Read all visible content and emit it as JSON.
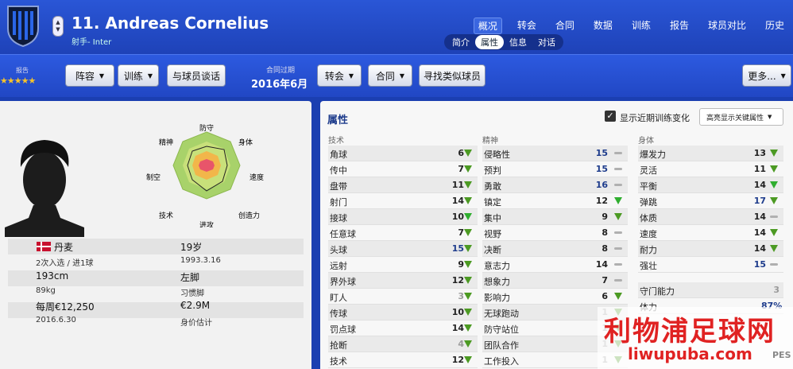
{
  "header": {
    "player_name": "11. Andreas Cornelius",
    "subtitle": "射手- Inter",
    "updown": [
      "▲",
      "▼"
    ]
  },
  "nav": [
    "概况",
    "转会",
    "合同",
    "数据",
    "训练",
    "报告",
    "球员对比",
    "历史"
  ],
  "subtabs": [
    "简介",
    "属性",
    "信息",
    "对话"
  ],
  "toolbar": {
    "report_label": "报告",
    "stars": "★★★★★",
    "lineup": "阵容",
    "training": "训练",
    "talk": "与球员谈话",
    "contract_exp_label": "合同过期",
    "contract_exp_date": "2016年6月",
    "transfer": "转会",
    "contract": "合同",
    "find_similar": "寻找类似球员",
    "more": "更多..."
  },
  "radar": {
    "labels": [
      "防守",
      "身体",
      "速度",
      "创造力",
      "进攻",
      "技术",
      "制空",
      "精神"
    ]
  },
  "profile": {
    "nation": "丹麦",
    "age": "19岁",
    "caps": "2次入选 / 进1球",
    "dob": "1993.3.16",
    "height": "193cm",
    "foot": "左脚",
    "weight": "89kg",
    "foot_label": "习惯脚",
    "wage": "每周€12,250",
    "value": "€2.9M",
    "contract_end": "2016.6.30",
    "value_label": "身价估计"
  },
  "attrs": {
    "title": "属性",
    "checkbox": "显示近期训练变化",
    "dropdown": "高亮显示关键属性",
    "col_tech": "技术",
    "col_mental": "精神",
    "col_phys": "身体",
    "tech": [
      [
        "角球",
        "6",
        "up"
      ],
      [
        "传中",
        "7",
        "up"
      ],
      [
        "盘带",
        "11",
        "up"
      ],
      [
        "射门",
        "14",
        "up"
      ],
      [
        "接球",
        "10",
        "upg"
      ],
      [
        "任意球",
        "7",
        "up"
      ],
      [
        "头球",
        "15",
        "up"
      ],
      [
        "远射",
        "9",
        "up"
      ],
      [
        "界外球",
        "12",
        "up"
      ],
      [
        "盯人",
        "3",
        "up"
      ],
      [
        "传球",
        "10",
        "up"
      ],
      [
        "罚点球",
        "14",
        "up"
      ],
      [
        "抢断",
        "4",
        "up"
      ],
      [
        "技术",
        "12",
        "up"
      ]
    ],
    "mental": [
      [
        "侵略性",
        "15",
        "flat"
      ],
      [
        "预判",
        "15",
        "flat"
      ],
      [
        "勇敢",
        "16",
        "flat"
      ],
      [
        "镇定",
        "12",
        "upg"
      ],
      [
        "集中",
        "9",
        "up"
      ],
      [
        "视野",
        "8",
        "flat"
      ],
      [
        "决断",
        "8",
        "flat"
      ],
      [
        "意志力",
        "14",
        "flat"
      ],
      [
        "想象力",
        "7",
        "flat"
      ],
      [
        "影响力",
        "6",
        "up"
      ],
      [
        "无球跑动",
        "1",
        "up"
      ],
      [
        "防守站位",
        "1",
        "up"
      ],
      [
        "团队合作",
        "1",
        "up"
      ],
      [
        "工作投入",
        "1",
        "up"
      ]
    ],
    "phys": [
      [
        "爆发力",
        "13",
        "up"
      ],
      [
        "灵活",
        "11",
        "up"
      ],
      [
        "平衡",
        "14",
        "upg"
      ],
      [
        "弹跳",
        "17",
        "up"
      ],
      [
        "体质",
        "14",
        "flat"
      ],
      [
        "速度",
        "14",
        "up"
      ],
      [
        "耐力",
        "14",
        "up"
      ],
      [
        "强壮",
        "15",
        "flat"
      ]
    ],
    "gk": [
      "守门能力",
      "3"
    ],
    "fitness": [
      "体力",
      "87%"
    ]
  },
  "watermark": {
    "cn": "利物浦足球网",
    "url": "liwupuba.com",
    "logo": "PES"
  },
  "colors": {
    "accent": "#2147c4",
    "blue_val": "#1e3c8c",
    "arrow": "#3a9a1e"
  }
}
